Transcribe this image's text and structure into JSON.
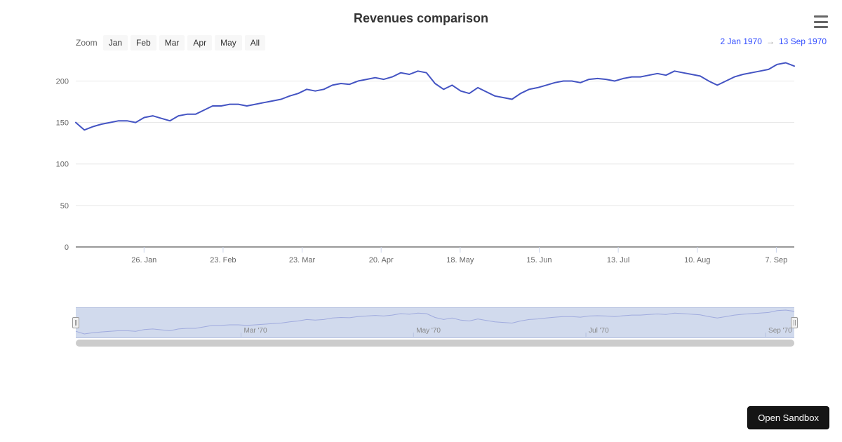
{
  "chart_data": {
    "type": "line",
    "title": "Revenues comparison",
    "xlabel": "",
    "ylabel": "",
    "ylim": [
      0,
      230
    ],
    "x": [
      "2 Jan",
      "5 Jan",
      "8 Jan",
      "11 Jan",
      "14 Jan",
      "17 Jan",
      "20 Jan",
      "23 Jan",
      "26 Jan",
      "29 Jan",
      "1 Feb",
      "4 Feb",
      "7 Feb",
      "10 Feb",
      "13 Feb",
      "16 Feb",
      "19 Feb",
      "23 Feb",
      "26 Feb",
      "1 Mar",
      "4 Mar",
      "7 Mar",
      "10 Mar",
      "13 Mar",
      "16 Mar",
      "19 Mar",
      "23 Mar",
      "26 Mar",
      "29 Mar",
      "1 Apr",
      "4 Apr",
      "7 Apr",
      "10 Apr",
      "13 Apr",
      "16 Apr",
      "20 Apr",
      "23 Apr",
      "26 Apr",
      "29 Apr",
      "2 May",
      "5 May",
      "8 May",
      "11 May",
      "14 May",
      "18 May",
      "21 May",
      "24 May",
      "27 May",
      "30 May",
      "2 Jun",
      "5 Jun",
      "8 Jun",
      "11 Jun",
      "15 Jun",
      "18 Jun",
      "21 Jun",
      "24 Jun",
      "27 Jun",
      "30 Jun",
      "3 Jul",
      "6 Jul",
      "9 Jul",
      "13 Jul",
      "16 Jul",
      "19 Jul",
      "22 Jul",
      "25 Jul",
      "28 Jul",
      "31 Jul",
      "3 Aug",
      "6 Aug",
      "10 Aug",
      "13 Aug",
      "16 Aug",
      "19 Aug",
      "22 Aug",
      "25 Aug",
      "28 Aug",
      "31 Aug",
      "3 Sep",
      "7 Sep",
      "10 Sep",
      "13 Sep"
    ],
    "series": [
      {
        "name": "Revenue",
        "values": [
          150,
          141,
          145,
          148,
          150,
          152,
          152,
          150,
          156,
          158,
          155,
          152,
          158,
          160,
          160,
          165,
          170,
          170,
          172,
          172,
          170,
          172,
          174,
          176,
          178,
          182,
          185,
          190,
          188,
          190,
          195,
          197,
          196,
          200,
          202,
          204,
          202,
          205,
          210,
          208,
          212,
          210,
          197,
          190,
          195,
          188,
          185,
          192,
          187,
          182,
          180,
          178,
          185,
          190,
          192,
          195,
          198,
          200,
          200,
          198,
          202,
          203,
          202,
          200,
          203,
          205,
          205,
          207,
          209,
          207,
          212,
          210,
          208,
          206,
          200,
          195,
          200,
          205,
          208,
          210,
          212,
          214,
          220,
          222,
          218
        ]
      }
    ],
    "y_ticks": [
      0,
      50,
      100,
      150,
      200
    ],
    "x_ticks": [
      "26. Jan",
      "23. Feb",
      "23. Mar",
      "20. Apr",
      "18. May",
      "15. Jun",
      "13. Jul",
      "10. Aug",
      "7. Sep"
    ],
    "navigator_ticks": [
      "Mar '70",
      "May '70",
      "Jul '70",
      "Sep '70"
    ]
  },
  "header": {
    "title": "Revenues comparison"
  },
  "zoom": {
    "label": "Zoom",
    "buttons": [
      "Jan",
      "Feb",
      "Mar",
      "Apr",
      "May",
      "All"
    ]
  },
  "range": {
    "from": "2 Jan 1970",
    "to": "13 Sep 1970"
  },
  "sandbox": {
    "label": "Open Sandbox"
  }
}
